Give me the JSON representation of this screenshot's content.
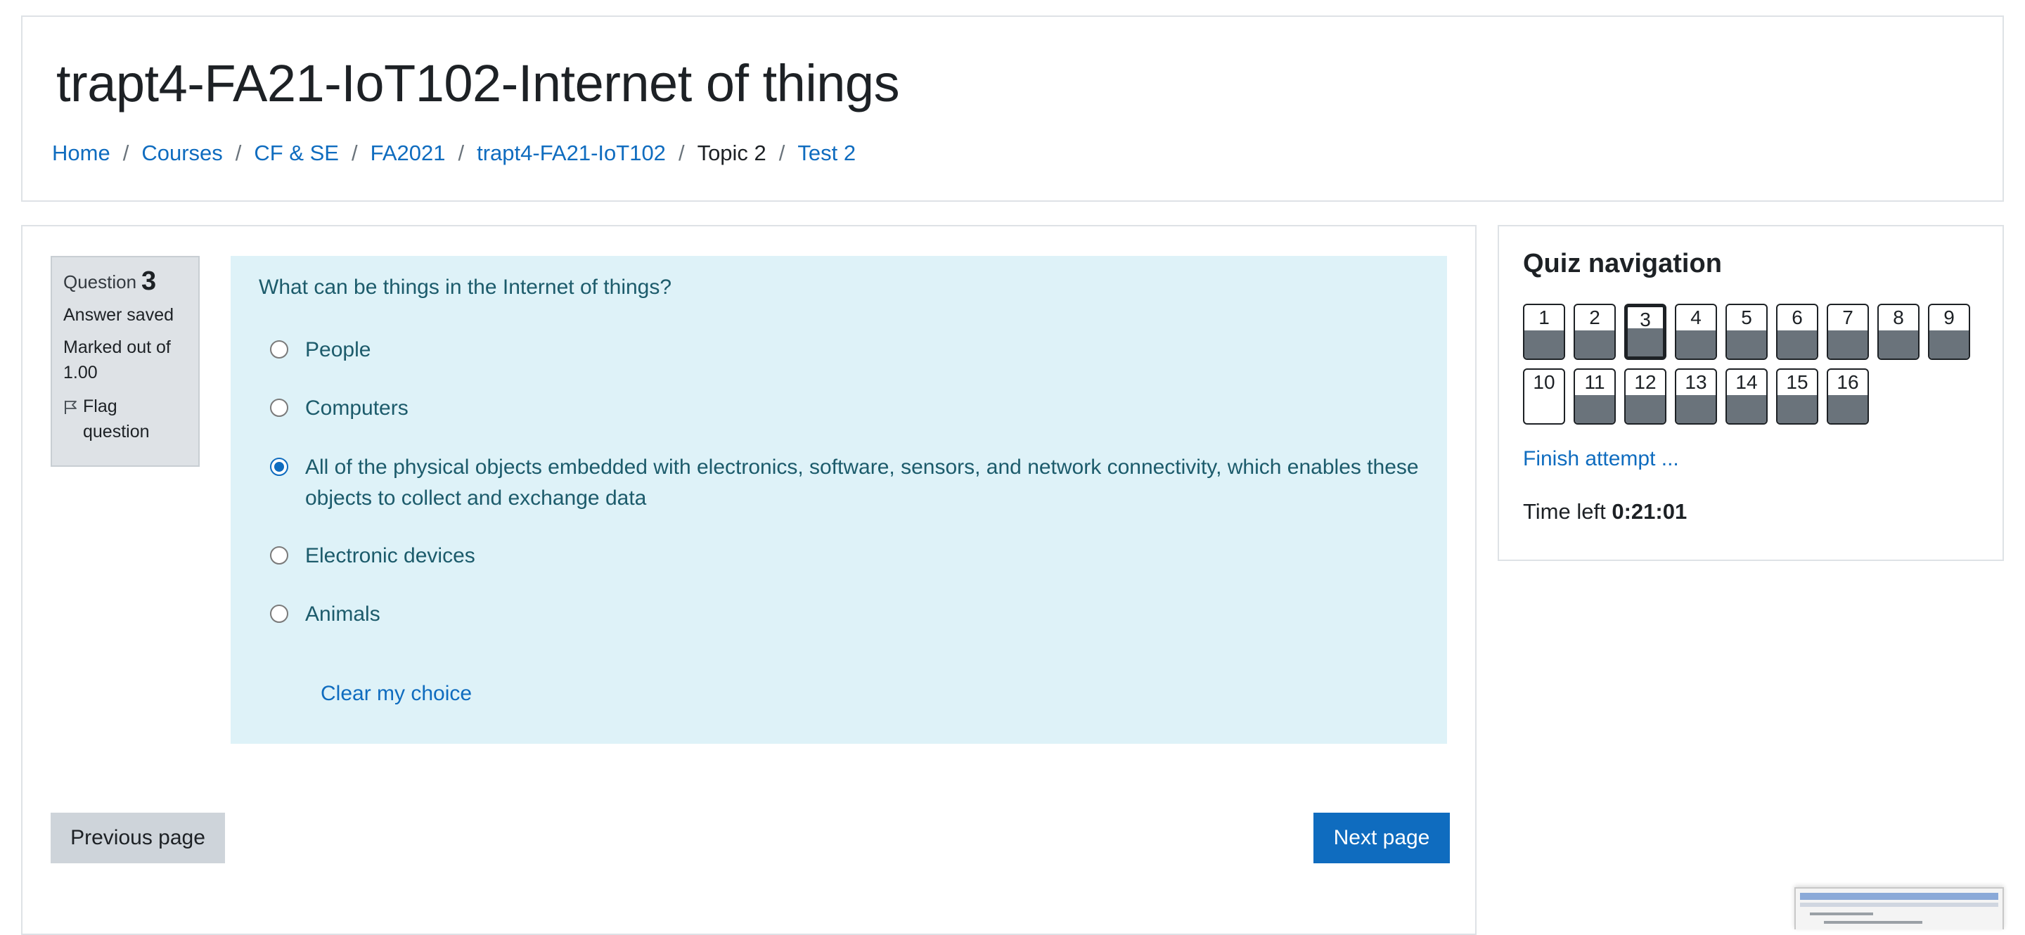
{
  "course": {
    "title": "trapt4-FA21-IoT102-Internet of things"
  },
  "breadcrumb": [
    {
      "label": "Home",
      "link": true
    },
    {
      "label": "Courses",
      "link": true
    },
    {
      "label": "CF & SE",
      "link": true
    },
    {
      "label": "FA2021",
      "link": true
    },
    {
      "label": "trapt4-FA21-IoT102",
      "link": true
    },
    {
      "label": "Topic 2",
      "link": false
    },
    {
      "label": "Test 2",
      "link": true
    }
  ],
  "question_info": {
    "question_label": "Question",
    "question_number": "3",
    "state": "Answer saved",
    "marked_out_of": "Marked out of 1.00",
    "flag_label": "Flag question"
  },
  "question": {
    "text": "What can be things in the Internet of things?",
    "answers": [
      {
        "label": "People",
        "checked": false
      },
      {
        "label": "Computers",
        "checked": false
      },
      {
        "label": "All of the physical objects embedded with electronics, software, sensors, and network connectivity, which enables these objects to collect and exchange data",
        "checked": true
      },
      {
        "label": "Electronic devices",
        "checked": false
      },
      {
        "label": "Animals",
        "checked": false
      }
    ],
    "clear_choice": "Clear my choice"
  },
  "buttons": {
    "previous": "Previous page",
    "next": "Next page"
  },
  "quiz_nav": {
    "title": "Quiz navigation",
    "questions": [
      {
        "num": "1",
        "answered": true,
        "current": false
      },
      {
        "num": "2",
        "answered": true,
        "current": false
      },
      {
        "num": "3",
        "answered": true,
        "current": true
      },
      {
        "num": "4",
        "answered": true,
        "current": false
      },
      {
        "num": "5",
        "answered": true,
        "current": false
      },
      {
        "num": "6",
        "answered": true,
        "current": false
      },
      {
        "num": "7",
        "answered": true,
        "current": false
      },
      {
        "num": "8",
        "answered": true,
        "current": false
      },
      {
        "num": "9",
        "answered": true,
        "current": false
      },
      {
        "num": "10",
        "answered": false,
        "current": false
      },
      {
        "num": "11",
        "answered": true,
        "current": false
      },
      {
        "num": "12",
        "answered": true,
        "current": false
      },
      {
        "num": "13",
        "answered": true,
        "current": false
      },
      {
        "num": "14",
        "answered": true,
        "current": false
      },
      {
        "num": "15",
        "answered": true,
        "current": false
      },
      {
        "num": "16",
        "answered": true,
        "current": false
      }
    ],
    "finish_label": "Finish attempt ...",
    "time_left_label": "Time left",
    "time_left_value": "0:21:01"
  },
  "colors": {
    "link": "#0f6cbf",
    "question_bg": "#def2f8",
    "question_text": "#1c5b6b",
    "answered_fill": "#6a737b",
    "primary_button": "#0f6cbf"
  }
}
